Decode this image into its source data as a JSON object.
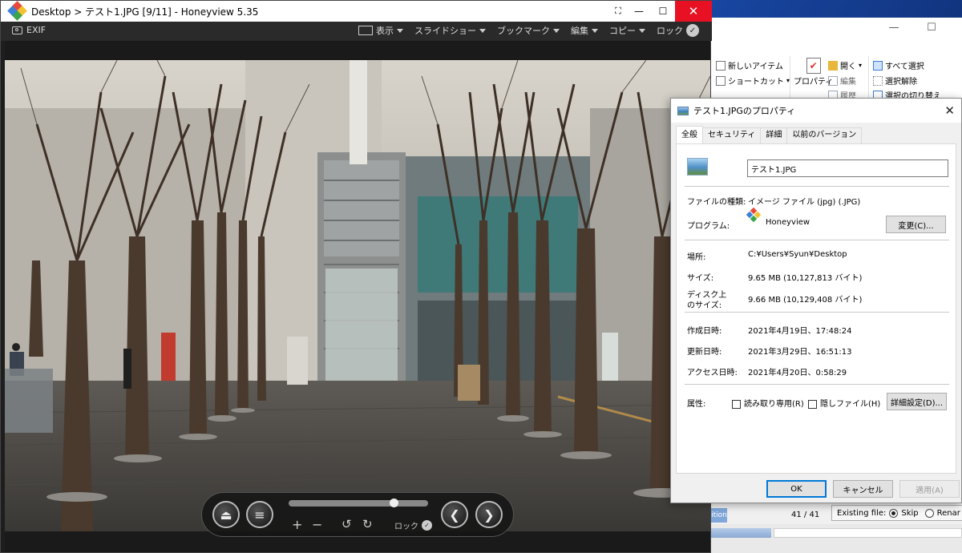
{
  "honeyview": {
    "title": "Desktop > テスト1.JPG [9/11] - Honeyview 5.35",
    "toolbar": {
      "exif": "EXIF",
      "menus": [
        "表示",
        "スライドショー",
        "ブックマーク",
        "編集",
        "コピー"
      ],
      "lock": "ロック"
    },
    "controls": {
      "plus": "+",
      "minus": "−",
      "lock": "ロック",
      "slider_position": 0.77
    }
  },
  "explorer": {
    "ribbon": {
      "new_item": "新しいアイテム",
      "shortcut": "ショートカット",
      "properties": "プロパティ",
      "open": "開く",
      "edit": "編集",
      "history": "履歴",
      "select_all": "すべて選択",
      "select_none": "選択解除",
      "invert_selection": "選択の切り替え"
    },
    "status": {
      "left_button": "ition",
      "counter": "41 / 41",
      "existing_file": "Existing file:",
      "skip": "Skip",
      "rename": "Renar"
    },
    "progress_fraction": 0.24
  },
  "dialog": {
    "title": "テスト1.JPGのプロパティ",
    "tabs": [
      "全般",
      "セキュリティ",
      "詳細",
      "以前のバージョン"
    ],
    "filename": "テスト1.JPG",
    "file_type_label": "ファイルの種類:",
    "file_type_value": "イメージ ファイル (jpg) (.JPG)",
    "program_label": "プログラム:",
    "program_value": "Honeyview",
    "change_button": "変更(C)...",
    "location_label": "場所:",
    "location_value": "C:¥Users¥Syun¥Desktop",
    "size_label": "サイズ:",
    "size_value": "9.65 MB (10,127,813 バイト)",
    "disk_size_label_1": "ディスク上",
    "disk_size_label_2": "のサイズ:",
    "disk_size_value": "9.66 MB (10,129,408 バイト)",
    "created_label": "作成日時:",
    "created_value": "2021年4月19日、17:48:24",
    "modified_label": "更新日時:",
    "modified_value": "2021年3月29日、16:51:13",
    "accessed_label": "アクセス日時:",
    "accessed_value": "2021年4月20日、0:58:29",
    "attributes_label": "属性:",
    "readonly_label": "読み取り専用(R)",
    "hidden_label": "隠しファイル(H)",
    "advanced_button": "詳細設定(D)...",
    "ok": "OK",
    "cancel": "キャンセル",
    "apply": "適用(A)"
  },
  "colors": {
    "close_red": "#e81123",
    "accent_blue": "#0078d7"
  }
}
